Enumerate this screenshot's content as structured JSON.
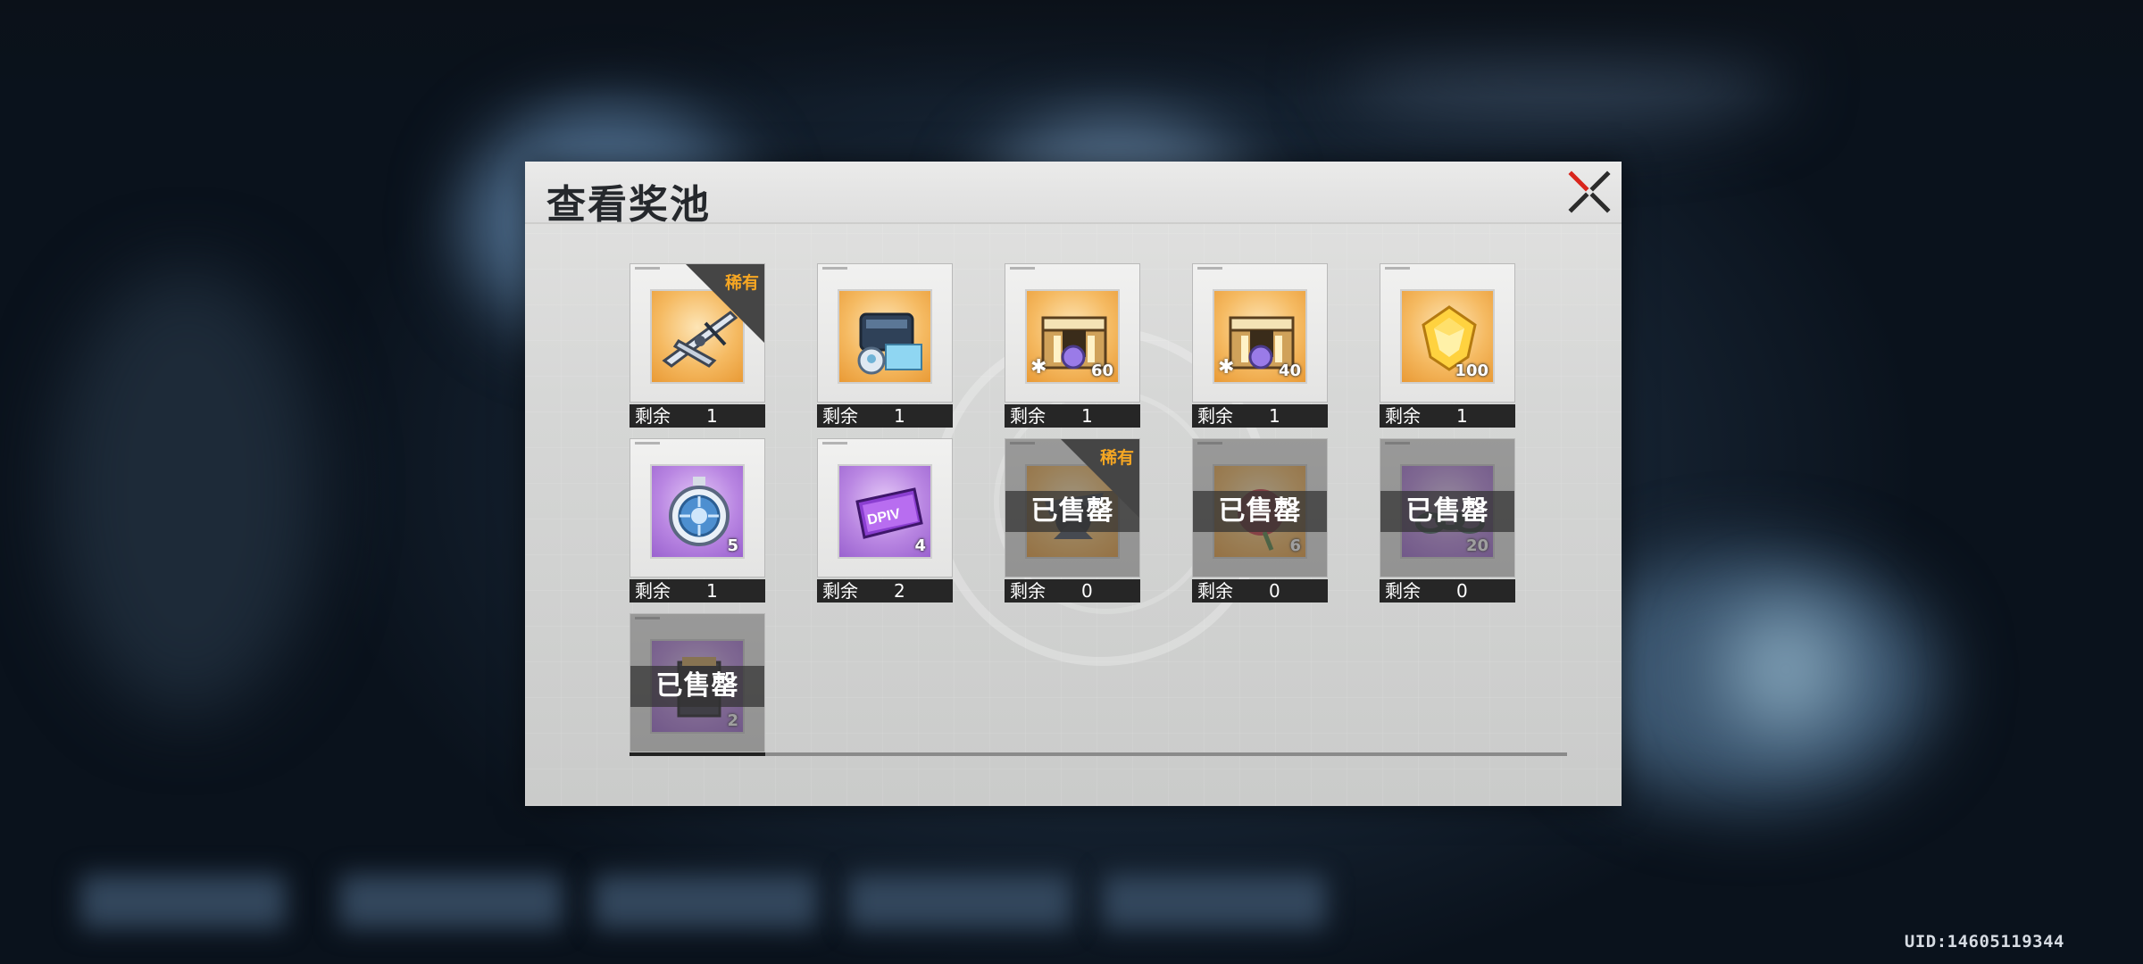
{
  "dialog": {
    "title": "查看奖池"
  },
  "items": [
    {
      "name": "silver-crossbow-item",
      "bg": "gold",
      "rare": true,
      "qty": "",
      "puzzle": false,
      "sold": false,
      "remain": "1"
    },
    {
      "name": "device-item",
      "bg": "gold",
      "rare": false,
      "qty": "",
      "puzzle": false,
      "sold": false,
      "remain": "1"
    },
    {
      "name": "chest-item",
      "bg": "gold",
      "rare": false,
      "qty": "60",
      "puzzle": true,
      "sold": false,
      "remain": "1"
    },
    {
      "name": "chest-item",
      "bg": "gold",
      "rare": false,
      "qty": "40",
      "puzzle": true,
      "sold": false,
      "remain": "1"
    },
    {
      "name": "gold-gem-item",
      "bg": "gold",
      "rare": false,
      "qty": "100",
      "puzzle": false,
      "sold": false,
      "remain": "1"
    },
    {
      "name": "stopwatch-item",
      "bg": "purple",
      "rare": false,
      "qty": "5",
      "puzzle": false,
      "sold": false,
      "remain": "1"
    },
    {
      "name": "ticket-item",
      "bg": "purple",
      "rare": false,
      "qty": "4",
      "puzzle": false,
      "sold": false,
      "remain": "2"
    },
    {
      "name": "black-figure-item",
      "bg": "gold",
      "rare": true,
      "qty": "",
      "puzzle": false,
      "sold": true,
      "remain": "0"
    },
    {
      "name": "red-rose-item",
      "bg": "gold",
      "rare": false,
      "qty": "6",
      "puzzle": false,
      "sold": true,
      "remain": "0"
    },
    {
      "name": "chain-item",
      "bg": "purple",
      "rare": false,
      "qty": "20",
      "puzzle": false,
      "sold": true,
      "remain": "0"
    },
    {
      "name": "box-item",
      "bg": "purple",
      "rare": false,
      "qty": "2",
      "puzzle": false,
      "sold": true,
      "remain": ""
    }
  ],
  "labels": {
    "rare": "稀有",
    "sold_out": "已售罄",
    "remain": "剩余",
    "ticket_text": "DPIV"
  },
  "uid": "UID:14605119344",
  "colors": {
    "rare_accent": "#f5a623",
    "gold_bg": "#f5ba62",
    "purple_bg": "#b986e2"
  }
}
